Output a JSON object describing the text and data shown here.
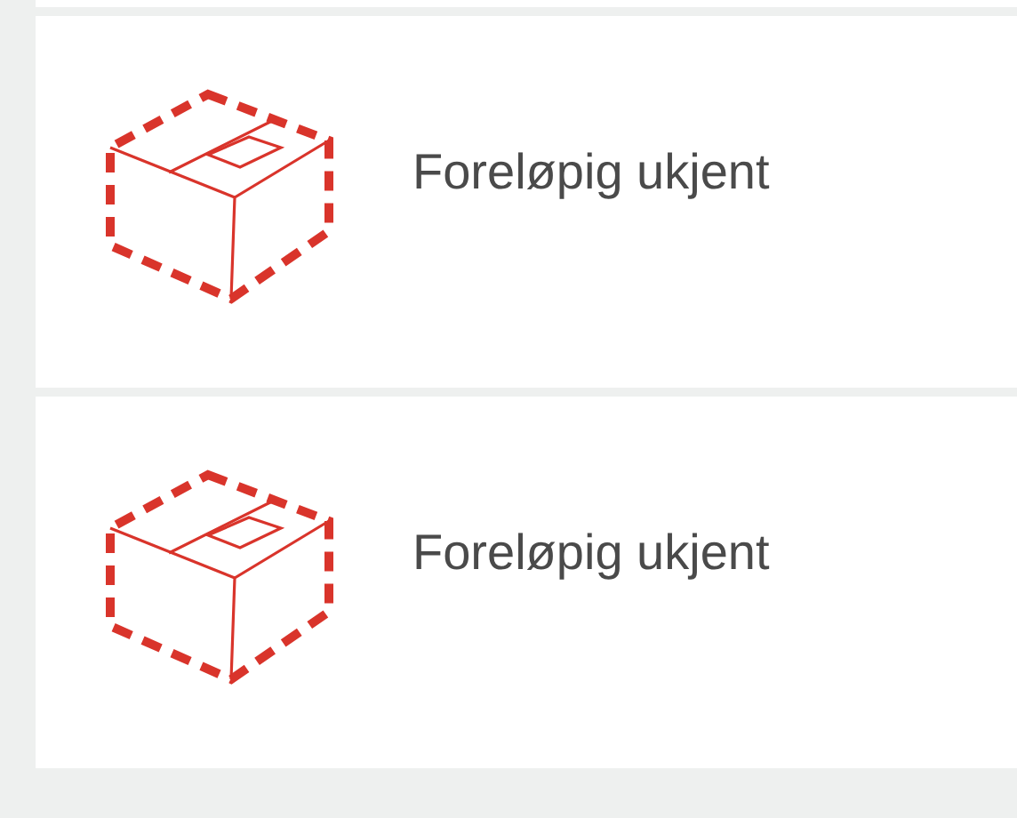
{
  "items": [
    {
      "label": "Foreløpig ukjent"
    },
    {
      "label": "Foreløpig ukjent"
    }
  ]
}
